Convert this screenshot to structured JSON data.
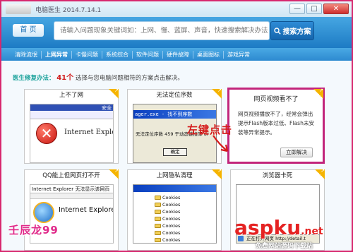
{
  "window": {
    "title": "电脑医生",
    "version": "2014.7.14.1",
    "minimize_label": "—",
    "maximize_label": "□",
    "close_label": "✕"
  },
  "header": {
    "home_label": "首 页",
    "search_placeholder": "请输入问题现象关键词如：上网、慢、蓝屏、声音，快速搜索解决办法",
    "search_button_label": "搜索方案"
  },
  "nav": {
    "items": [
      "清除流氓",
      "上网异常",
      "卡慢问题",
      "系统综合",
      "软件问题",
      "硬件故障",
      "桌面图标",
      "游戏异常"
    ]
  },
  "info": {
    "label": "医生修复办法：",
    "count": "41个",
    "desc": "选择与您电脑问题相符的方案点击解决。"
  },
  "cards": {
    "no_internet": {
      "title": "上不了网",
      "thumb_bar_text": "安全",
      "thumb_text": "Internet Explorer"
    },
    "entry_point": {
      "title": "无法定位序数",
      "dialog_title": "ager.exe - 找不到序数",
      "dialog_message": "无法定位序数 459 于动态链接库 ur",
      "dialog_ok": "确定"
    },
    "video": {
      "title": "网页视频看不了",
      "desc": "网页视频播放不了，经常会弹出提示Flash版本过低、Flash未安装等异常提示。",
      "button": "立即解决"
    },
    "qq": {
      "title": "QQ能上但网页打不开",
      "thumb_msg": "Internet Explorer 无法显示该网页",
      "thumb_text": "Internet Explore"
    },
    "privacy": {
      "title": "上网隐私清理",
      "files": [
        "Cookies",
        "Cookies",
        "Cookies",
        "Cookies",
        "Cookies",
        "Cookies",
        "Cookies"
      ]
    },
    "slow_browser": {
      "title": "浏览器卡死",
      "status": "正在打开网页 http://detail.t"
    }
  },
  "annotation": {
    "text": "左键点击"
  },
  "watermarks": {
    "author": "壬辰龙99",
    "site_main": "asp",
    "site_ku": "ku",
    "site_net": ".net",
    "site_sub": "免费网站源码下载站"
  },
  "colors": {
    "highlight_border": "#c2257b",
    "annotation": "#d51a1a",
    "header_blue": "#1d7bc4",
    "corner_tag": "#f5b400"
  }
}
